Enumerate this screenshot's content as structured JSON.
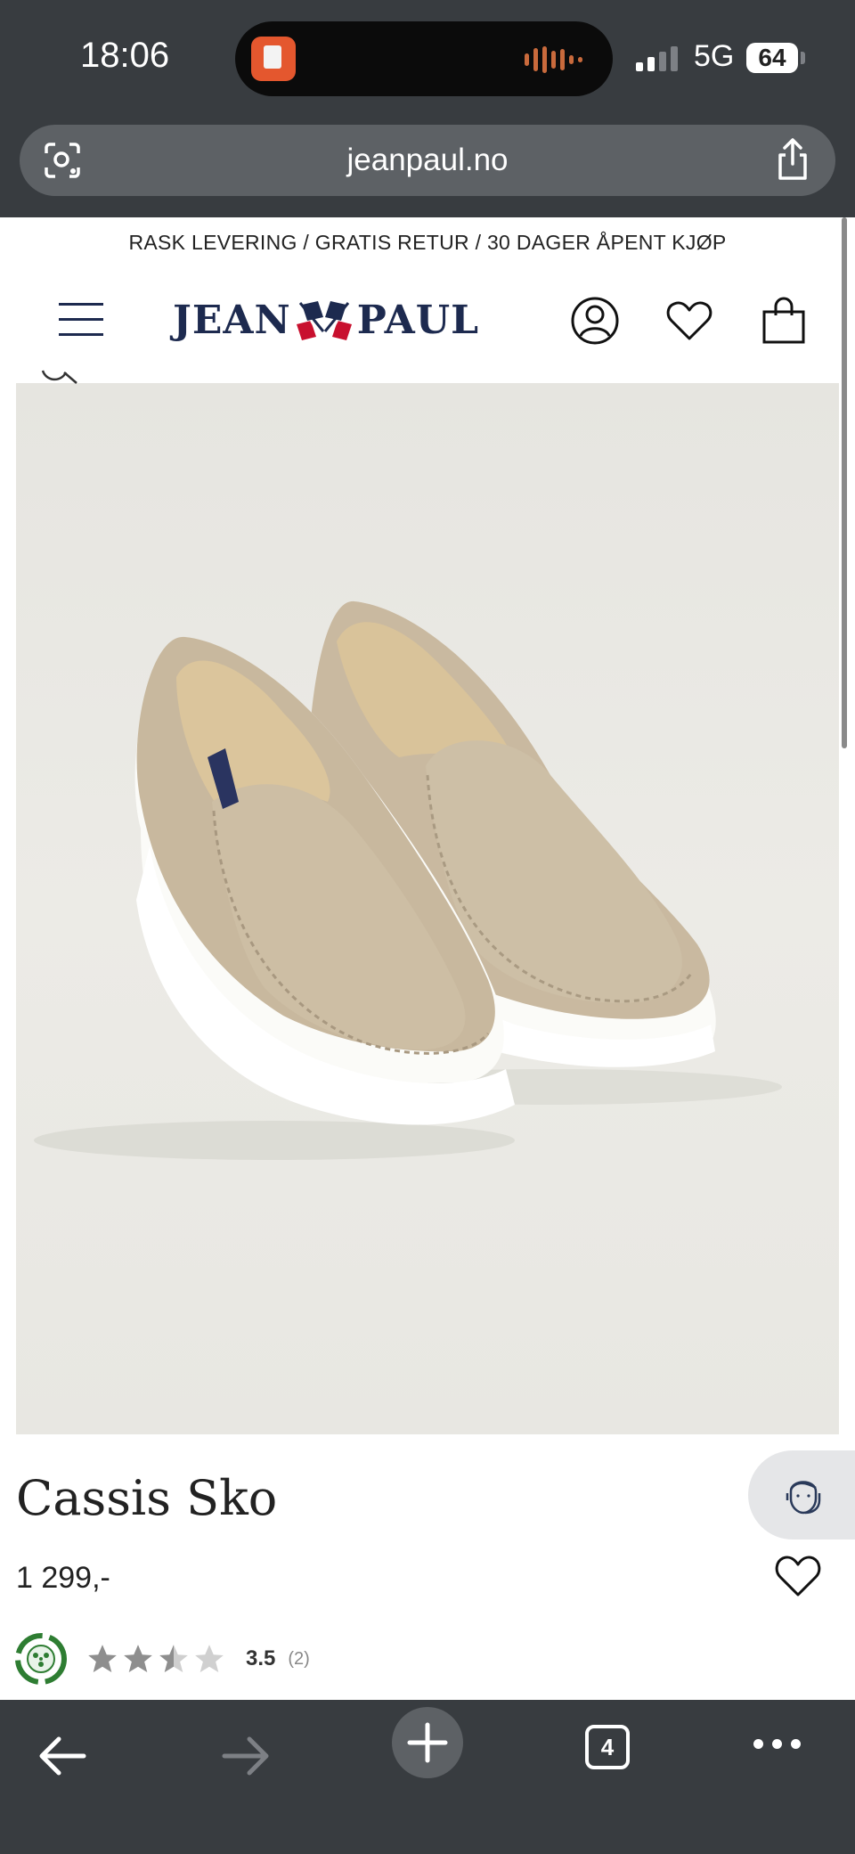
{
  "status_bar": {
    "time": "18:06",
    "network": "5G",
    "battery": "64"
  },
  "browser": {
    "url": "jeanpaul.no",
    "tab_count": "4"
  },
  "promo_banner": "RASK LEVERING / GRATIS RETUR / 30 DAGER ÅPENT KJØP",
  "header": {
    "logo_left": "JEAN",
    "logo_right": "PAUL"
  },
  "product": {
    "title": "Cassis Sko",
    "price": "1 299,-",
    "rating": {
      "score": "3.5",
      "count": "(2)",
      "stars_value": 3.5,
      "stars_max": 5
    }
  },
  "colors": {
    "chrome": "#383c40",
    "brand_navy": "#1d2a4f",
    "brand_red": "#c8102e",
    "rating_green": "#2e7d32"
  }
}
